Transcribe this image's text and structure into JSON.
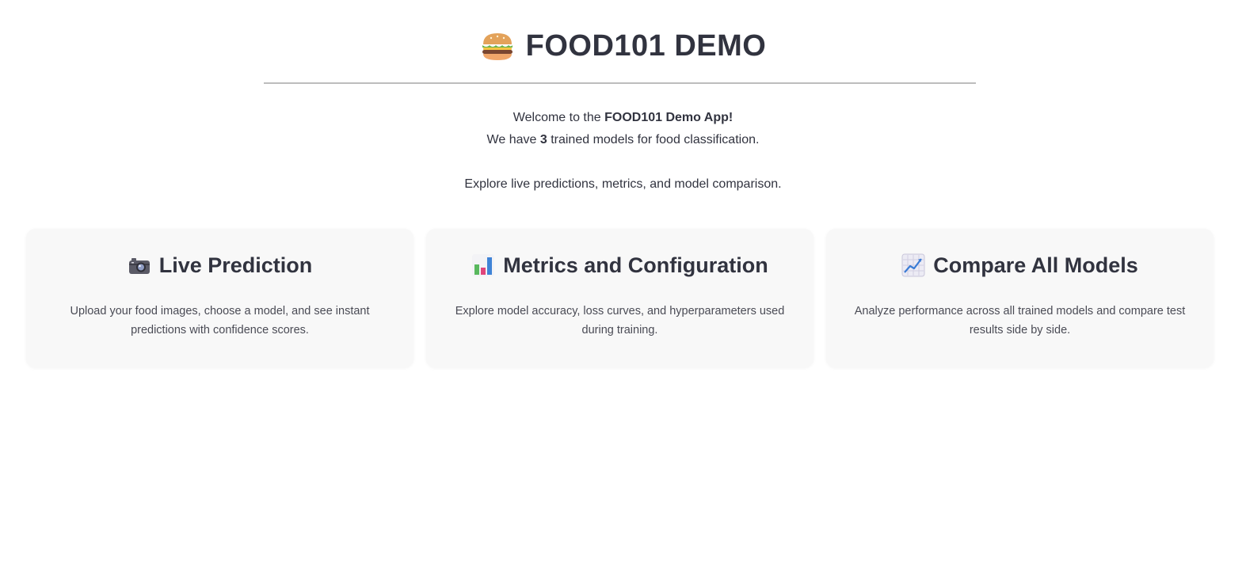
{
  "header": {
    "icon": "burger-icon",
    "title": "FOOD101 DEMO"
  },
  "intro": {
    "line1_prefix": "Welcome to the ",
    "line1_bold": "FOOD101 Demo App!",
    "line2_prefix": "We have ",
    "line2_bold": "3",
    "line2_suffix": " trained models for food classification.",
    "line3": "Explore live predictions, metrics, and model comparison."
  },
  "cards": [
    {
      "icon": "camera-icon",
      "title": "Live Prediction",
      "description": "Upload your food images, choose a model, and see instant predictions with confidence scores."
    },
    {
      "icon": "bar-chart-icon",
      "title": "Metrics and Configuration",
      "description": "Explore model accuracy, loss curves, and hyperparameters used during training."
    },
    {
      "icon": "line-chart-icon",
      "title": "Compare All Models",
      "description": "Analyze performance across all trained models and compare test results side by side."
    }
  ]
}
